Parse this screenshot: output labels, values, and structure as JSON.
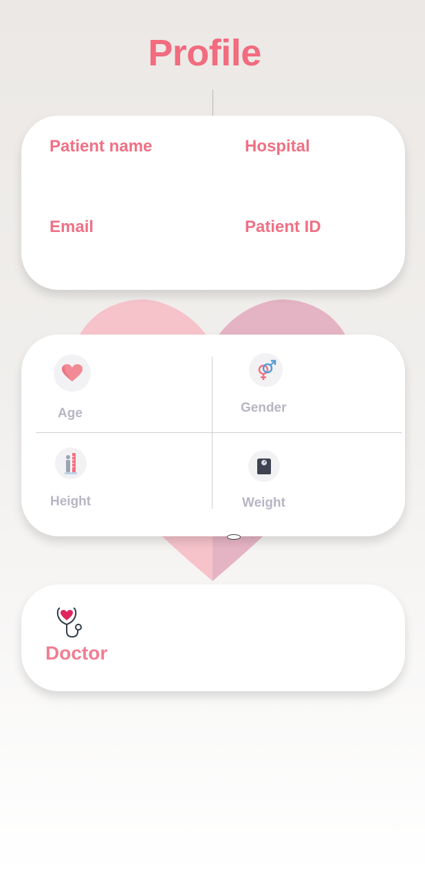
{
  "header": {
    "title": "Profile"
  },
  "profile_fields": {
    "patient_name_label": "Patient name",
    "hospital_label": "Hospital",
    "email_label": "Email",
    "patient_id_label": "Patient ID"
  },
  "stats": {
    "age_label": "Age",
    "gender_label": "Gender",
    "height_label": "Height",
    "weight_label": "Weight"
  },
  "doctor": {
    "label": "Doctor"
  },
  "colors": {
    "accent": "#f26b7e",
    "stat_label": "#b6b6c4",
    "heart_left": "#f6c3cb",
    "heart_right": "#e4b4c4"
  },
  "icons": {
    "age": "heart-icon",
    "gender": "gender-icon",
    "height": "height-icon",
    "weight": "scale-icon",
    "doctor": "stethoscope-icon"
  }
}
